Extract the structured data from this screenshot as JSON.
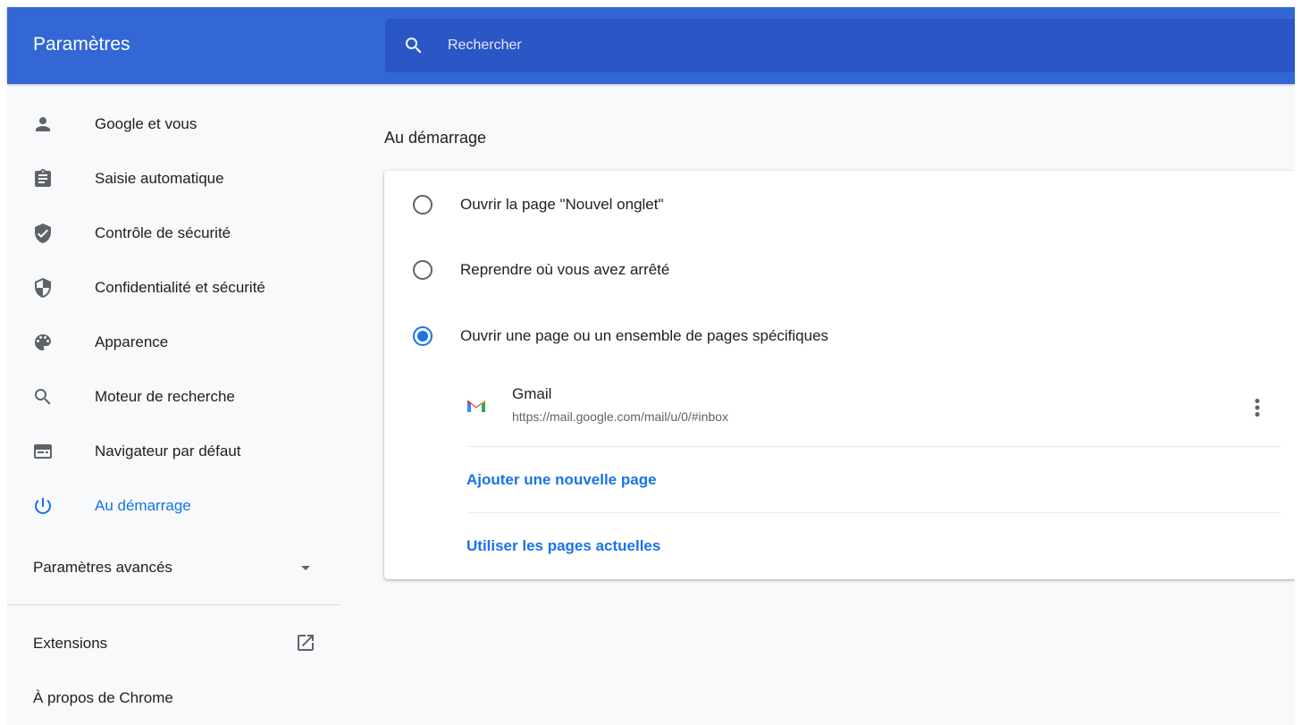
{
  "toolbar": {
    "title": "Paramètres",
    "search_placeholder": "Rechercher"
  },
  "sidebar": {
    "items": [
      {
        "label": "Google et vous",
        "icon": "person-icon"
      },
      {
        "label": "Saisie automatique",
        "icon": "clipboard-icon"
      },
      {
        "label": "Contrôle de sécurité",
        "icon": "shield-check-icon"
      },
      {
        "label": "Confidentialité et sécurité",
        "icon": "shield-half-icon"
      },
      {
        "label": "Apparence",
        "icon": "palette-icon"
      },
      {
        "label": "Moteur de recherche",
        "icon": "search-icon"
      },
      {
        "label": "Navigateur par défaut",
        "icon": "browser-icon"
      },
      {
        "label": "Au démarrage",
        "icon": "power-icon",
        "active": true
      }
    ],
    "advanced_label": "Paramètres avancés",
    "extensions_label": "Extensions",
    "about_label": "À propos de Chrome"
  },
  "main": {
    "section_title": "Au démarrage",
    "options": [
      {
        "label": "Ouvrir la page \"Nouvel onglet\"",
        "checked": false
      },
      {
        "label": "Reprendre où vous avez arrêté",
        "checked": false
      },
      {
        "label": "Ouvrir une page ou un ensemble de pages spécifiques",
        "checked": true
      }
    ],
    "pages": [
      {
        "name": "Gmail",
        "url": "https://mail.google.com/mail/u/0/#inbox",
        "icon": "gmail-icon"
      }
    ],
    "add_page_label": "Ajouter une nouvelle page",
    "use_current_label": "Utiliser les pages actuelles"
  },
  "colors": {
    "toolbar": "#3367d6",
    "search": "#2a56c6",
    "accent": "#1a73e8",
    "icon": "#5f6368"
  }
}
